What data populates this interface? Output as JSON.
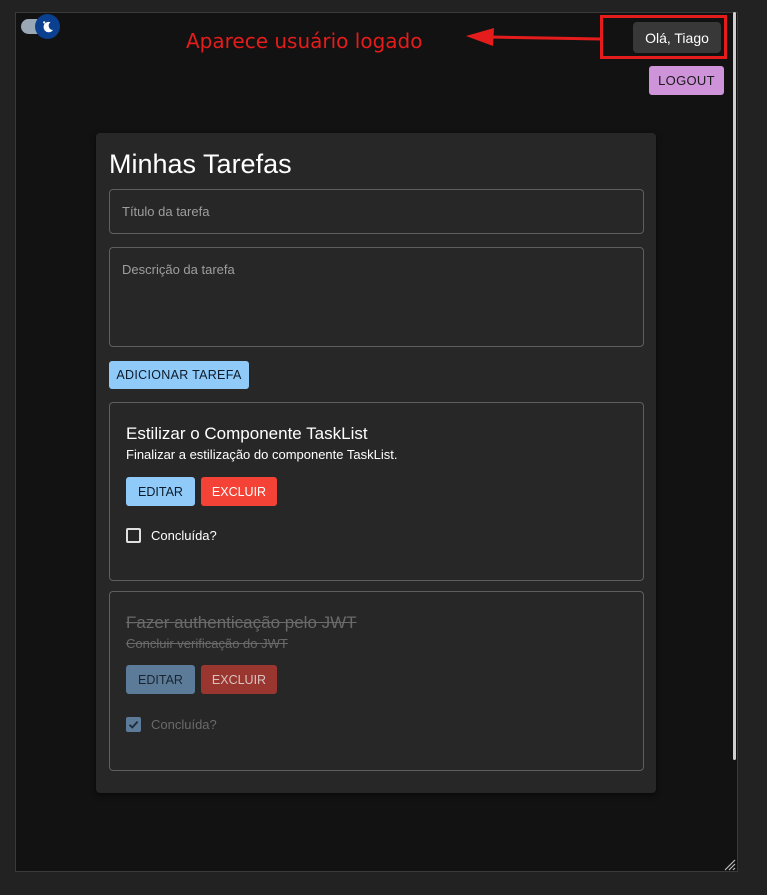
{
  "theme_toggle": {
    "icon": "moon-icon",
    "state": "dark"
  },
  "annotation": {
    "text": "Aparece usuário logado",
    "color": "#e51c1c"
  },
  "header": {
    "greeting": "Olá, Tiago",
    "logout_label": "LOGOUT"
  },
  "main": {
    "title": "Minhas Tarefas",
    "title_placeholder": "Título da tarefa",
    "description_placeholder": "Descrição da tarefa",
    "add_button_label": "ADICIONAR TAREFA"
  },
  "tasks": [
    {
      "title": "Estilizar o Componente TaskList",
      "description": "Finalizar a estilização do componente TaskList.",
      "edit_label": "EDITAR",
      "delete_label": "EXCLUIR",
      "completed_label": "Concluída?",
      "completed": false
    },
    {
      "title": "Fazer authenticação pelo JWT",
      "description": "Concluir verificação do JWT",
      "edit_label": "EDITAR",
      "delete_label": "EXCLUIR",
      "completed_label": "Concluída?",
      "completed": true
    }
  ],
  "colors": {
    "primary": "#90caf9",
    "error": "#f44336",
    "secondary": "#ce93d8",
    "background": "#121212",
    "paper": "#272727"
  }
}
